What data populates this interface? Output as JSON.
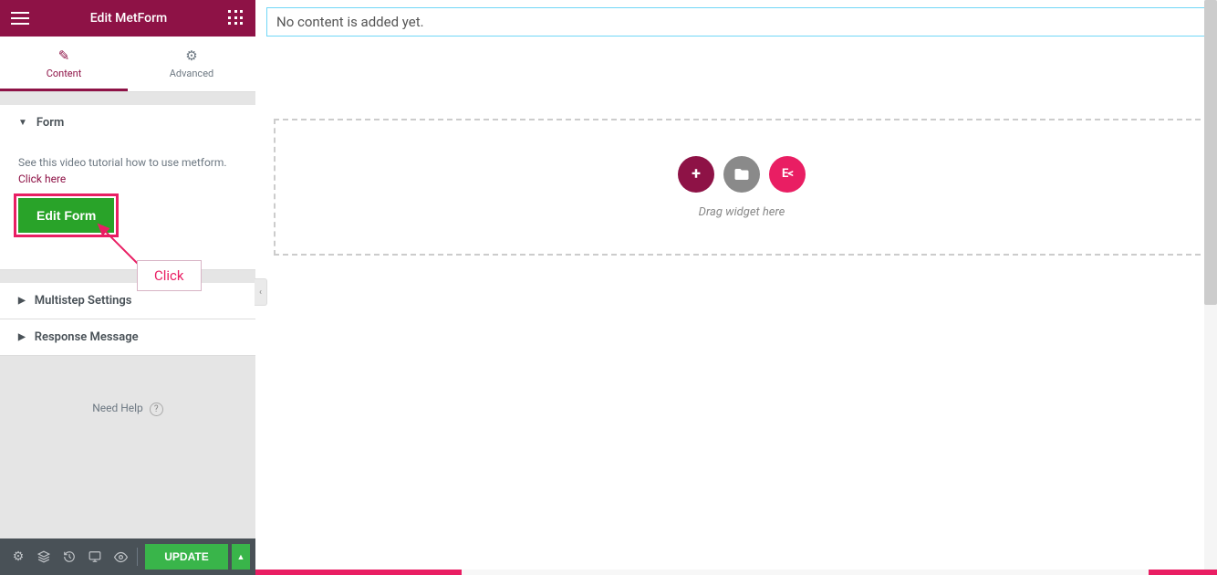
{
  "header": {
    "title": "Edit MetForm"
  },
  "tabs": {
    "content": "Content",
    "advanced": "Advanced"
  },
  "sections": {
    "form": {
      "title": "Form",
      "helpText": "See this video tutorial how to use metform. ",
      "linkText": "Click here",
      "buttonLabel": "Edit Form"
    },
    "multistep": {
      "title": "Multistep Settings"
    },
    "response": {
      "title": "Response Message"
    }
  },
  "needHelp": "Need Help",
  "bottomBar": {
    "update": "UPDATE"
  },
  "main": {
    "banner": "No content is added yet.",
    "dragText": "Drag widget here"
  },
  "annotation": {
    "label": "Click"
  }
}
